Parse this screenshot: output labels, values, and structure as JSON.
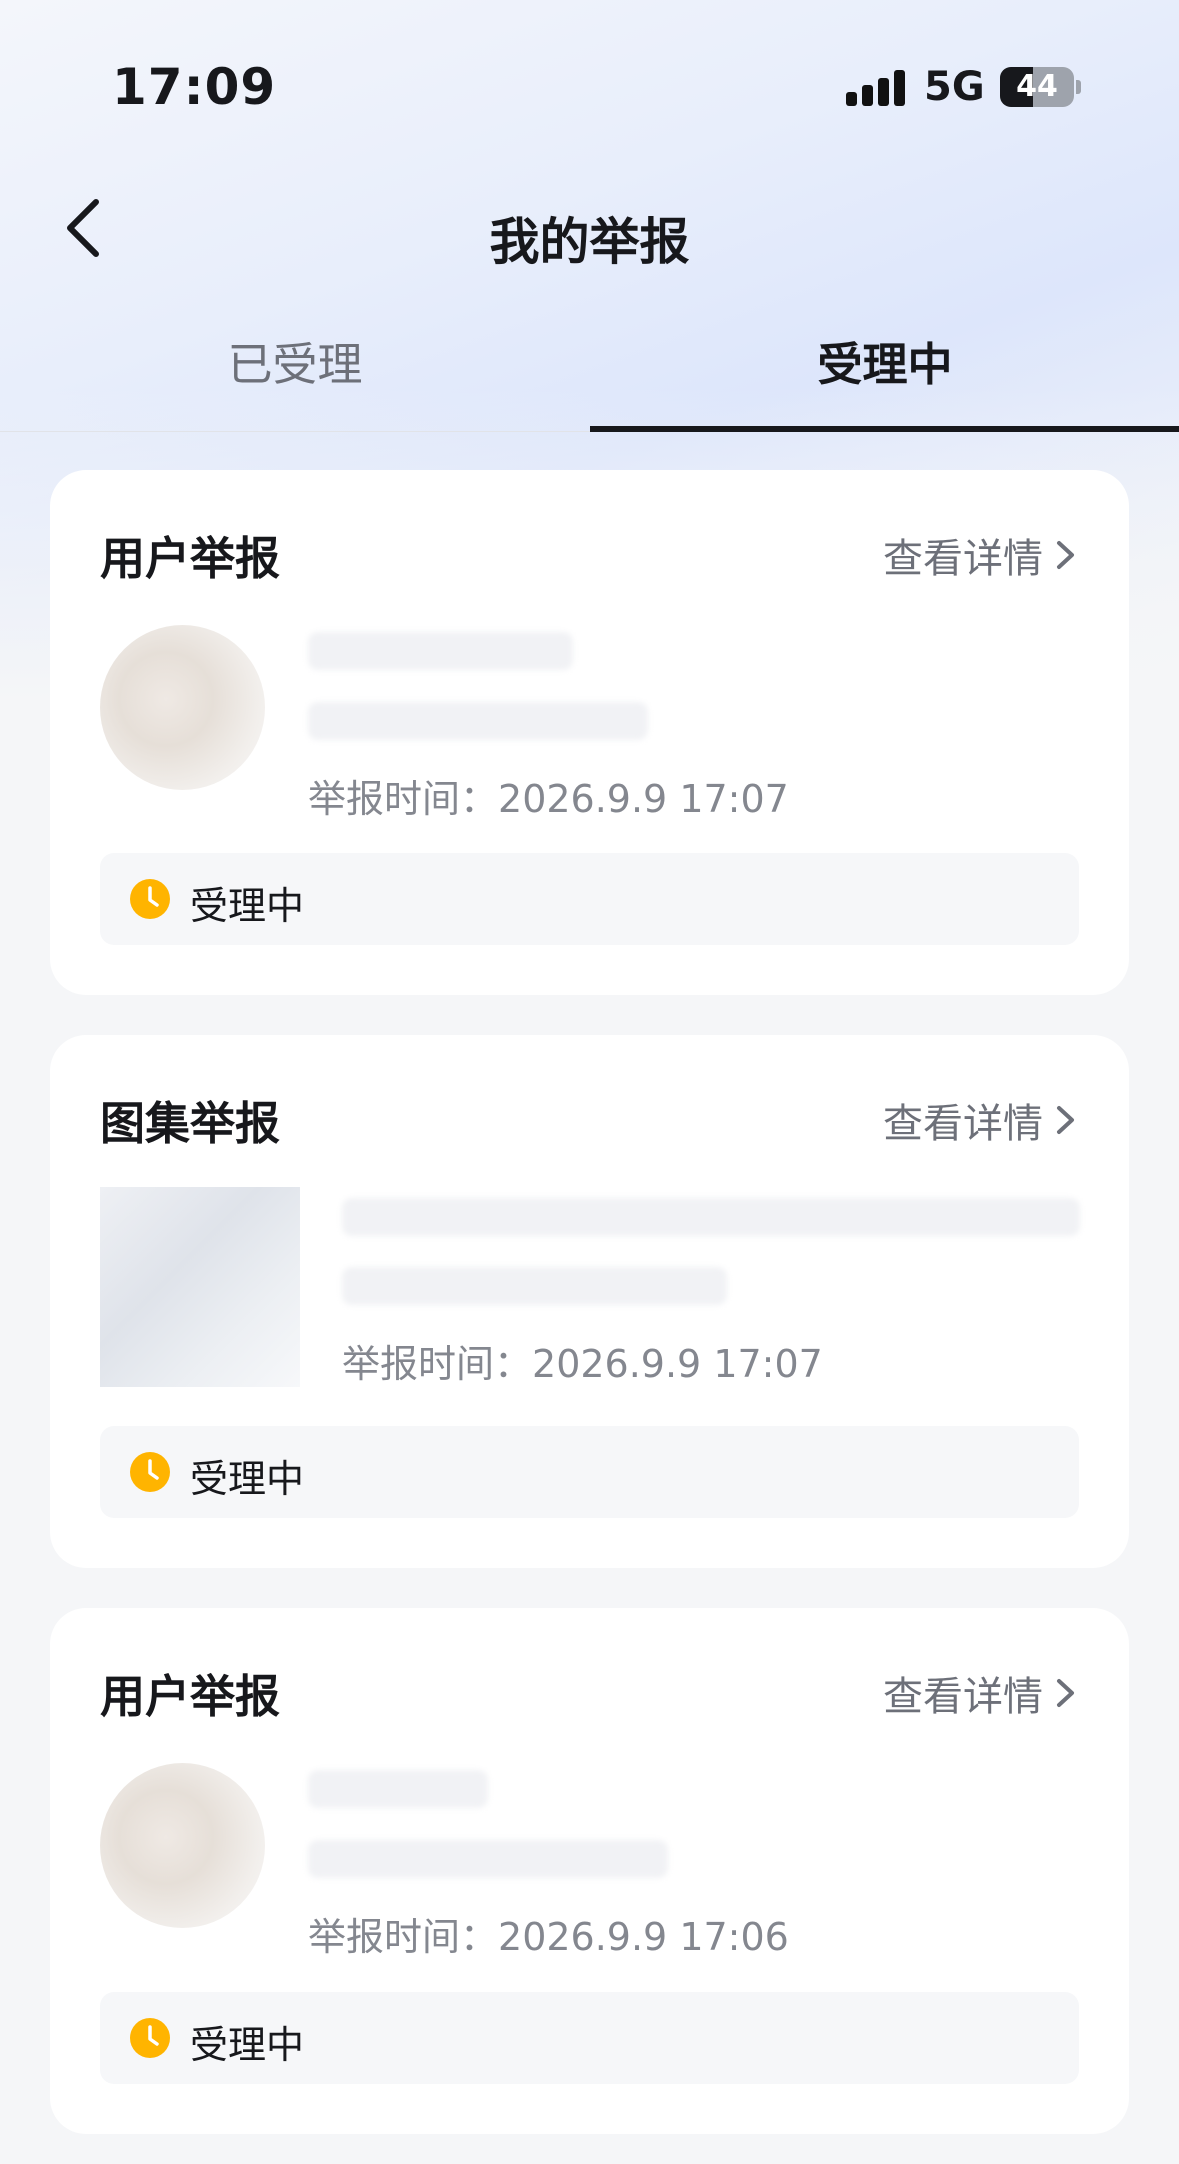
{
  "status_bar": {
    "time": "17:09",
    "network": "5G",
    "battery": "44",
    "battery_level": 0.44
  },
  "nav": {
    "title": "我的举报"
  },
  "tabs": [
    {
      "label": "已受理",
      "selected": false
    },
    {
      "label": "受理中",
      "selected": true
    }
  ],
  "reports": [
    {
      "type": "用户举报",
      "detail_label": "查看详情",
      "thumbnail": "avatar",
      "time_label": "举报时间：",
      "time": "2026.9.9 17:07",
      "status": "受理中"
    },
    {
      "type": "图集举报",
      "detail_label": "查看详情",
      "thumbnail": "image",
      "time_label": "举报时间：",
      "time": "2026.9.9 17:07",
      "status": "受理中"
    },
    {
      "type": "用户举报",
      "detail_label": "查看详情",
      "thumbnail": "avatar",
      "time_label": "举报时间：",
      "time": "2026.9.9 17:06",
      "status": "受理中"
    }
  ],
  "colors": {
    "status_icon": "#FFB400",
    "text_primary": "#17181C",
    "text_secondary": "#6D7079"
  },
  "icons": {
    "back": "chevron-left-icon",
    "detail": "chevron-right-icon",
    "status": "clock-icon"
  }
}
